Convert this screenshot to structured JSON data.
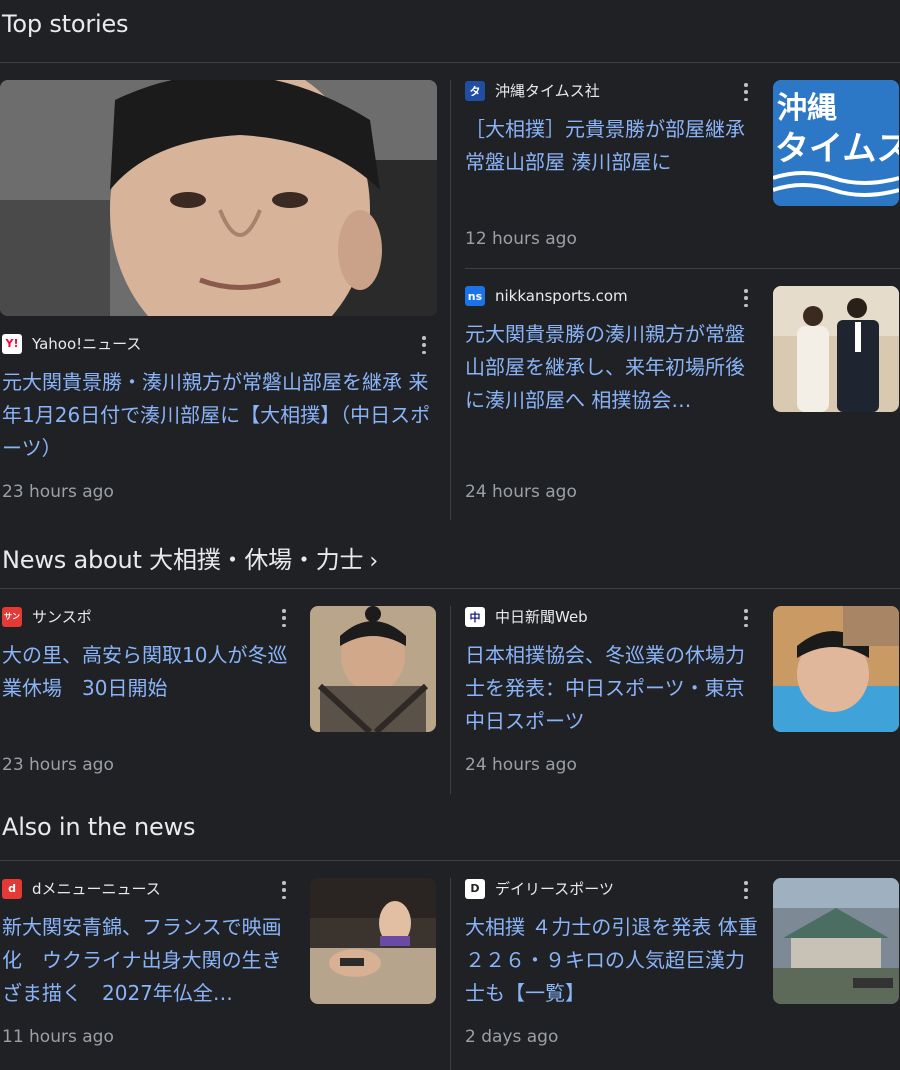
{
  "sections": {
    "top_stories": "Top stories",
    "news_about": "News about 大相撲・休場・力士",
    "news_about_arrow": "›",
    "also_in_news": "Also in the news"
  },
  "stories": [
    {
      "source": "Yahoo!ニュース",
      "favicon_text": "Y!",
      "favicon_color": "#ffffff",
      "favicon_fg": "#ff0033",
      "headline": "元大関貴景勝・湊川親方が常磐山部屋を継承 来年1月26日付で湊川部屋に【大相撲】（中日スポーツ）",
      "time": "23 hours ago"
    },
    {
      "source": "沖縄タイムス社",
      "favicon_text": "タ",
      "favicon_color": "#1f4ea3",
      "favicon_fg": "#ffffff",
      "headline": "［大相撲］元貴景勝が部屋継承 常盤山部屋 湊川部屋に",
      "time": "12 hours ago",
      "thumb_text": "沖縄\nタイムス"
    },
    {
      "source": "nikkansports.com",
      "favicon_text": "ns",
      "favicon_color": "#1a73e8",
      "favicon_fg": "#ffffff",
      "headline": "元大関貴景勝の湊川親方が常盤山部屋を継承し、来年初場所後に湊川部屋へ 相撲協会…",
      "time": "24 hours ago"
    },
    {
      "source": "サンスポ",
      "favicon_text": "サン",
      "favicon_color": "#e53935",
      "favicon_fg": "#ffffff",
      "headline": "大の里、高安ら関取10人が冬巡業休場　30日開始",
      "time": "23 hours ago"
    },
    {
      "source": "中日新聞Web",
      "favicon_text": "中",
      "favicon_color": "#ffffff",
      "favicon_fg": "#1a237e",
      "headline": "日本相撲協会、冬巡業の休場力士を発表：中日スポーツ・東京中日スポーツ",
      "time": "24 hours ago"
    },
    {
      "source": "dメニューニュース",
      "favicon_text": "d",
      "favicon_color": "#e53935",
      "favicon_fg": "#ffffff",
      "headline": "新大関安青錦、フランスで映画化　ウクライナ出身大関の生きざま描く　2027年仏全…",
      "time": "11 hours ago"
    },
    {
      "source": "デイリースポーツ",
      "favicon_text": "D",
      "favicon_color": "#ffffff",
      "favicon_fg": "#222222",
      "headline": "大相撲 ４力士の引退を発表 体重２２６・９キロの人気超巨漢力士も【一覧】",
      "time": "2 days ago"
    }
  ]
}
